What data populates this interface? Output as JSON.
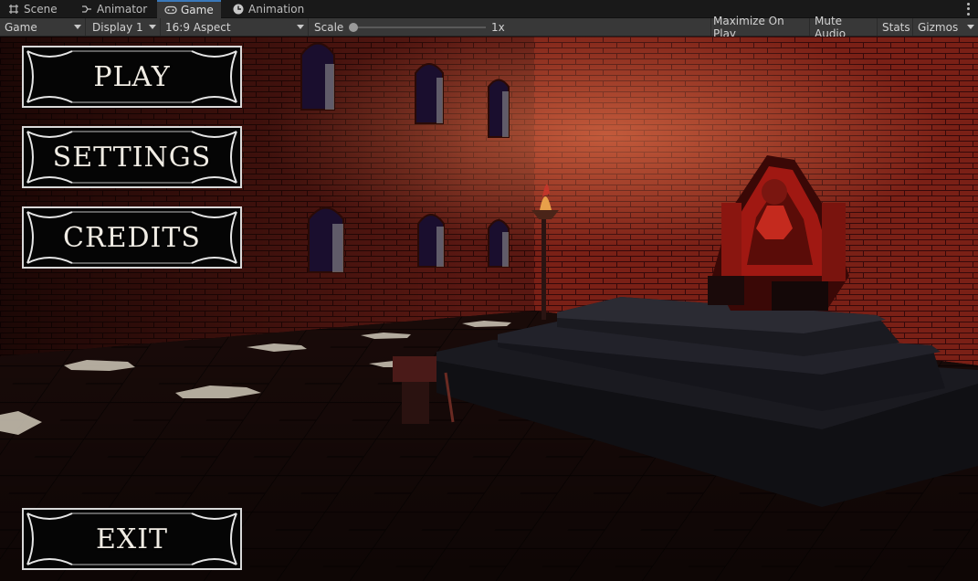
{
  "tabs": [
    {
      "label": "Scene",
      "icon": "grid-icon",
      "active": false
    },
    {
      "label": "Animator",
      "icon": "animator-icon",
      "active": false
    },
    {
      "label": "Game",
      "icon": "gamepad-icon",
      "active": true
    },
    {
      "label": "Animation",
      "icon": "clock-icon",
      "active": false
    }
  ],
  "toolbar": {
    "view_select": "Game",
    "display_select": "Display 1",
    "aspect_select": "16:9 Aspect",
    "scale_label": "Scale",
    "scale_value": "1x",
    "maximize_on_play": "Maximize On Play",
    "mute_audio": "Mute Audio",
    "stats": "Stats",
    "gizmos": "Gizmos"
  },
  "menu": {
    "play": "PLAY",
    "settings": "SETTINGS",
    "credits": "CREDITS",
    "exit": "EXIT"
  },
  "colors": {
    "accent_tab": "#3a79bb",
    "brick": "#6a1c14",
    "throne": "#c0201a"
  }
}
